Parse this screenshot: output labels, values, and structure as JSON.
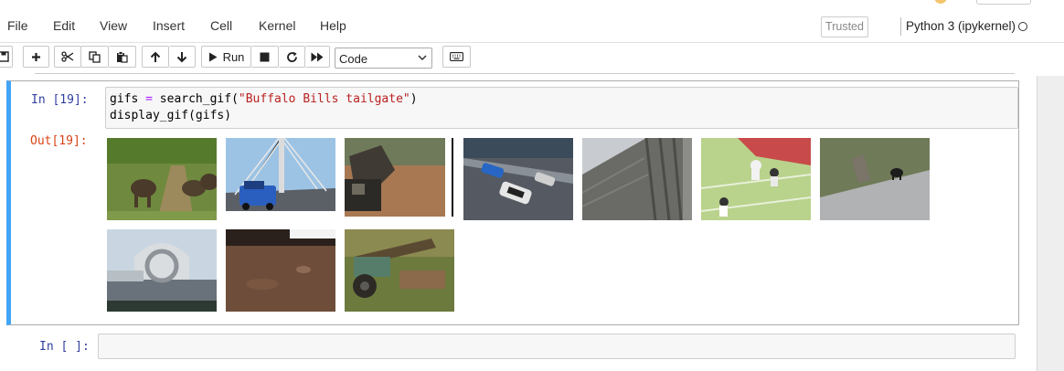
{
  "menubar": {
    "items": [
      "File",
      "Edit",
      "View",
      "Insert",
      "Cell",
      "Kernel",
      "Help"
    ],
    "trusted_label": "Trusted",
    "kernel_name": "Python 3 (ipykernel)"
  },
  "toolbar": {
    "run_label": "Run",
    "cell_type": "Code"
  },
  "cells": [
    {
      "in_prompt": "In [19]:",
      "code": {
        "line1_var": "gifs",
        "line1_op": "=",
        "line1_call": "search_gif(",
        "line1_str": "\"Buffalo Bills tailgate\"",
        "line1_end": ")",
        "line2": "display_gif(gifs)"
      },
      "out_prompt": "Out[19]:",
      "gifs": [
        {
          "subject": "elephants on a dirt track"
        },
        {
          "subject": "blue pickup truck on a bridge"
        },
        {
          "subject": "excavator bucket dumping dirt"
        },
        {
          "subject": "cars racing on a track"
        },
        {
          "subject": "tall building seen from below"
        },
        {
          "subject": "football players on the field"
        },
        {
          "subject": "bear near a portable toilet"
        },
        {
          "subject": "falkirk wheel boat lift"
        },
        {
          "subject": "vehicle on a dirt lot"
        },
        {
          "subject": "old tractor in the woods"
        }
      ]
    },
    {
      "in_prompt": "In [ ]:"
    }
  ]
}
